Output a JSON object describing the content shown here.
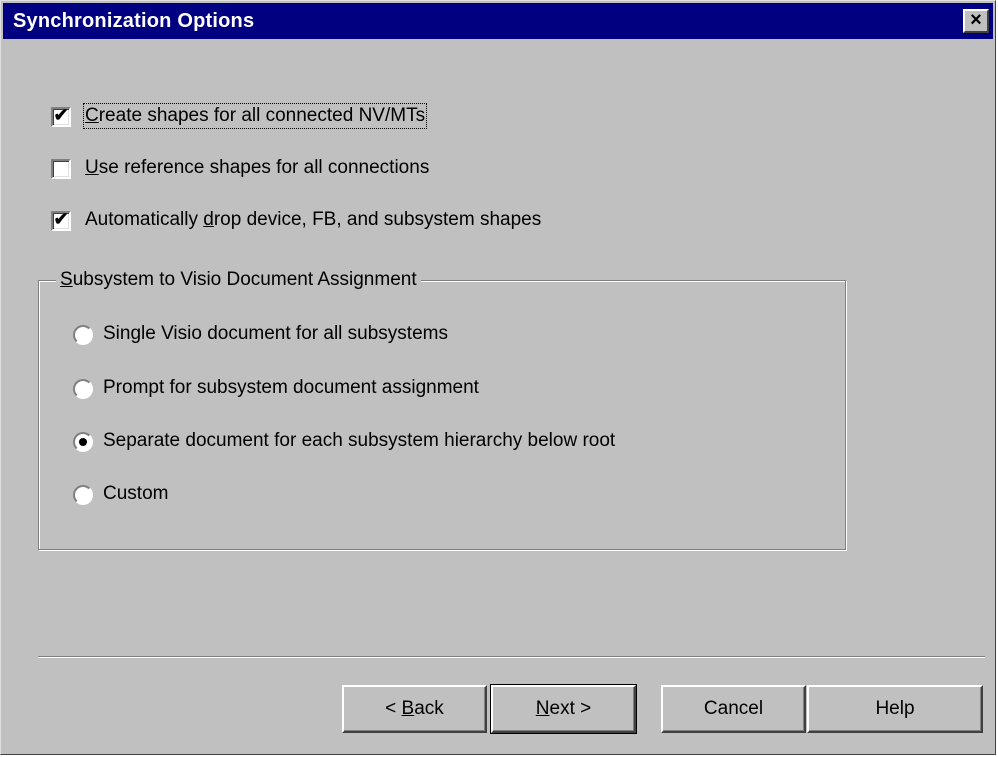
{
  "window": {
    "title": "Synchronization Options",
    "close_glyph": "×"
  },
  "options": {
    "create_shapes": {
      "pre": "",
      "key": "C",
      "post": "reate shapes for all connected NV/MTs",
      "checked": true
    },
    "reference_shapes": {
      "pre": "",
      "key": "U",
      "post": "se reference shapes for all connections",
      "checked": false
    },
    "auto_drop": {
      "pre": "Automatically ",
      "key": "d",
      "post": "rop device, FB, and subsystem shapes",
      "checked": true
    }
  },
  "group": {
    "title_pre": "",
    "title_key": "S",
    "title_post": "ubsystem to Visio Document Assignment",
    "radios": [
      {
        "label": "Single Visio document for all subsystems",
        "selected": false
      },
      {
        "label": "Prompt for subsystem document assignment",
        "selected": false
      },
      {
        "label": "Separate document for each subsystem hierarchy below root",
        "selected": true
      },
      {
        "label": "Custom",
        "selected": false
      }
    ]
  },
  "buttons": {
    "back": {
      "pre": "< ",
      "key": "B",
      "post": "ack"
    },
    "next": {
      "pre": "",
      "key": "N",
      "post": "ext >"
    },
    "cancel": "Cancel",
    "help": "Help"
  },
  "icons": {
    "check": "checkmark-icon",
    "close": "close-icon"
  }
}
